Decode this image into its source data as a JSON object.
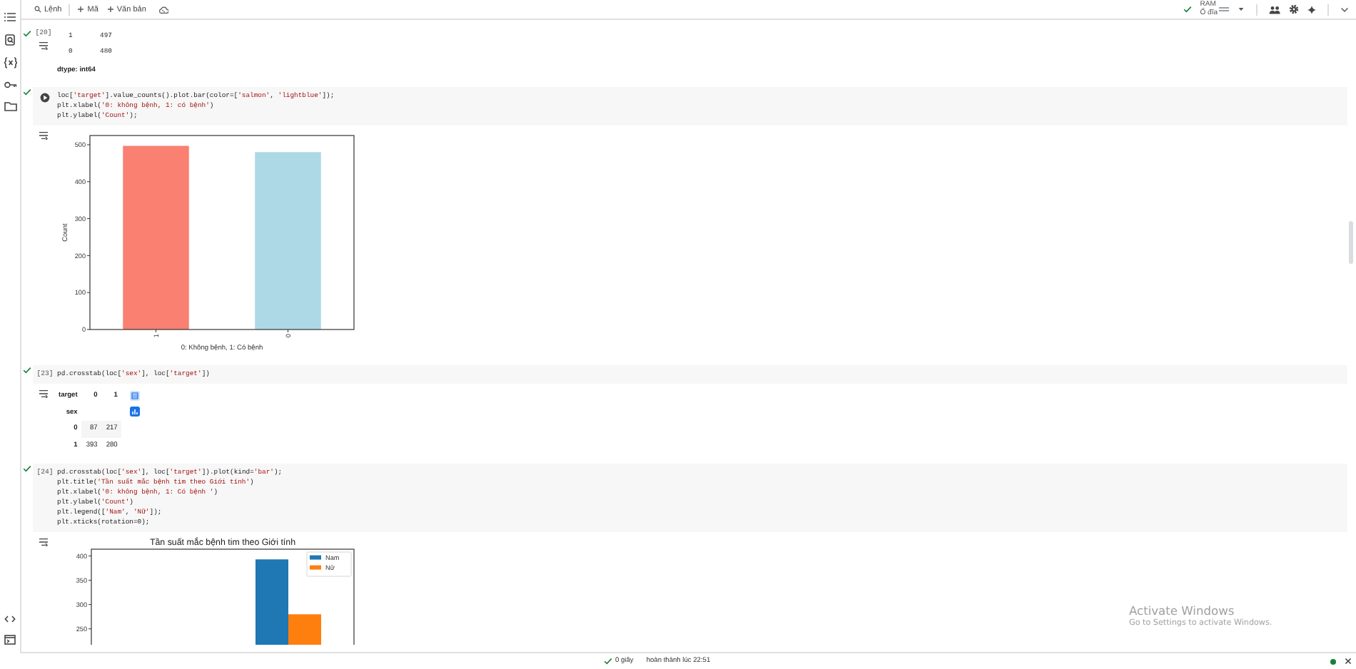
{
  "toolbar": {
    "commands": [
      {
        "kind": "search",
        "label": "Lệnh"
      },
      {
        "kind": "add",
        "label": "Mã"
      },
      {
        "kind": "add",
        "label": "Văn bản"
      }
    ],
    "runtime": {
      "connected": true,
      "ram_label": "RAM",
      "disk_label": "Ổ đĩa"
    }
  },
  "cells": [
    {
      "succeeded": true,
      "execution_count": "[20]",
      "run_button": false,
      "output": {
        "kind": "series",
        "rows": [
          {
            "index": "1",
            "value": "497"
          },
          {
            "index": "0",
            "value": "480"
          }
        ],
        "dtype": "dtype: int64"
      }
    },
    {
      "succeeded": true,
      "run_button": true,
      "code": [
        "loc['target'].value_counts().plot.bar(color=['salmon', 'lightblue']);",
        "plt.xlabel('0: không bệnh, 1: có bệnh')",
        "plt.ylabel('Count');"
      ],
      "output": {
        "kind": "chart",
        "chart_data": {
          "type": "bar",
          "xlabel": "0: Không bệnh, 1: Có bệnh",
          "ylabel": "Count",
          "categories": [
            "1",
            "0"
          ],
          "series": [
            {
              "values": [
                497,
                480
              ],
              "colors": [
                "#fa8072",
                "#add8e6"
              ]
            }
          ],
          "ylim": [
            0,
            525
          ],
          "yticks": [
            0,
            100,
            200,
            300,
            400,
            500
          ]
        }
      }
    },
    {
      "succeeded": true,
      "execution_count": "[23]",
      "run_button": false,
      "code": [
        "pd.crosstab(loc['sex'], loc['target'])"
      ],
      "output": {
        "kind": "table",
        "columns_name": "target",
        "columns": [
          "0",
          "1"
        ],
        "index_name": "sex",
        "rows": [
          {
            "index": "0",
            "cells": [
              "87",
              "217"
            ]
          },
          {
            "index": "1",
            "cells": [
              "393",
              "280"
            ]
          }
        ]
      }
    },
    {
      "succeeded": true,
      "execution_count": "[24]",
      "run_button": false,
      "code": [
        "pd.crosstab(loc['sex'], loc['target']).plot(kind='bar');",
        "plt.title('Tần suất mắc bệnh tim theo Giới tính')",
        "plt.xlabel('0: không bệnh, 1: Có bệnh ')",
        "plt.ylabel('Count')",
        "plt.legend(['Nam', 'Nữ']);",
        "plt.xticks(rotation=0);"
      ],
      "output": {
        "kind": "chart",
        "chart_data": {
          "type": "bar",
          "title": "Tần suất mắc bệnh tim theo Giới tính",
          "series": [
            {
              "name": "Nam",
              "color": "#1f77b4",
              "values": [
                null,
                393
              ]
            },
            {
              "name": "Nữ",
              "color": "#ff7f0e",
              "values": [
                null,
                280
              ]
            }
          ],
          "legend": true,
          "ylim": [
            0,
            414
          ],
          "yticks": [
            250,
            300,
            350,
            400
          ]
        }
      }
    }
  ],
  "status_bar": {
    "succeeded": true,
    "duration": "0 giây",
    "finished": "hoàn thành lúc 22:51",
    "connected": true
  },
  "os_notice": {
    "title": "Activate Windows",
    "message": "Go to Settings to activate Windows."
  }
}
